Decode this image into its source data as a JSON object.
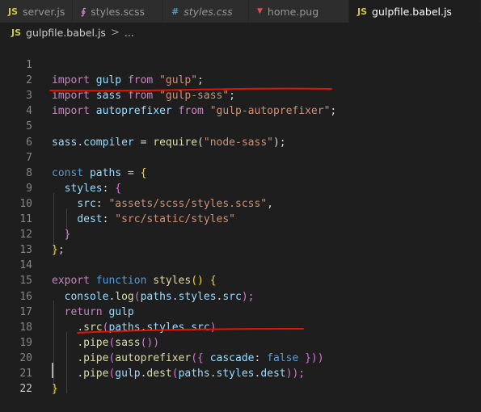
{
  "tabs": [
    {
      "icon": "JS",
      "label": "server.js",
      "icon_color": "#cbcb41"
    },
    {
      "icon": "∮",
      "label": "styles.scss",
      "icon_color": "#c586c0"
    },
    {
      "icon": "#",
      "label": "styles.css",
      "icon_color": "#519aba"
    },
    {
      "icon": "▼",
      "label": "home.pug",
      "icon_color": "#e44d4d"
    },
    {
      "icon": "JS",
      "label": "gulpfile.babel.js",
      "icon_color": "#cbcb41"
    }
  ],
  "active_tab": "gulpfile.babel.js",
  "breadcrumb": {
    "icon": "JS",
    "file": "gulpfile.babel.js",
    "separator": ">",
    "more": "..."
  },
  "lines": [
    {
      "n": "1"
    },
    {
      "n": "2"
    },
    {
      "n": "3"
    },
    {
      "n": "4"
    },
    {
      "n": "5"
    },
    {
      "n": "6"
    },
    {
      "n": "7"
    },
    {
      "n": "8"
    },
    {
      "n": "9"
    },
    {
      "n": "10"
    },
    {
      "n": "11"
    },
    {
      "n": "12"
    },
    {
      "n": "13"
    },
    {
      "n": "14"
    },
    {
      "n": "15"
    },
    {
      "n": "16"
    },
    {
      "n": "17"
    },
    {
      "n": "18"
    },
    {
      "n": "19"
    },
    {
      "n": "20"
    },
    {
      "n": "21"
    },
    {
      "n": "22"
    }
  ],
  "code": {
    "l1": [
      "import",
      "gulp",
      "from",
      "\"gulp\"",
      ";"
    ],
    "l2": [
      "import",
      "sass",
      "from",
      "\"gulp-sass\"",
      ";"
    ],
    "l3": [
      "import",
      "autoprefixer",
      "from",
      "\"gulp-autoprefixer\"",
      ";"
    ],
    "l5": [
      "sass",
      ".",
      "compiler",
      " = ",
      "require",
      "(",
      "\"node-sass\"",
      ");"
    ],
    "l7": [
      "const",
      "paths",
      " = ",
      "{"
    ],
    "l8": [
      "styles",
      ": ",
      "{"
    ],
    "l9": [
      "src",
      ": ",
      "\"assets/scss/styles.scss\"",
      ","
    ],
    "l10": [
      "dest",
      ": ",
      "\"src/static/styles\""
    ],
    "l11": [
      "}"
    ],
    "l12": [
      "}",
      ";"
    ],
    "l14": [
      "export",
      "function",
      "styles",
      "()",
      " {"
    ],
    "l15": [
      "console",
      ".",
      "log",
      "(",
      "paths",
      ".",
      "styles",
      ".",
      "src",
      ");"
    ],
    "l16": [
      "return",
      "gulp"
    ],
    "l17": [
      ".",
      "src",
      "(",
      "paths",
      ".",
      "styles",
      ".",
      "src",
      ")"
    ],
    "l18": [
      ".",
      "pipe",
      "(",
      "sass",
      "())"
    ],
    "l19": [
      ".",
      "pipe",
      "(",
      "autoprefixer",
      "({ ",
      "cascade",
      ": ",
      "false",
      " }))"
    ],
    "l20": [
      ".",
      "pipe",
      "(",
      "gulp",
      ".",
      "dest",
      "(",
      "paths",
      ".",
      "styles",
      ".",
      "dest",
      "));"
    ],
    "l21": [
      "}"
    ]
  },
  "colors": {
    "keyword": "#c586c0",
    "string": "#ce9178",
    "variable": "#9cdcfe",
    "function": "#dcdcaa",
    "storage": "#569cd6",
    "annotation": "#e51400"
  }
}
